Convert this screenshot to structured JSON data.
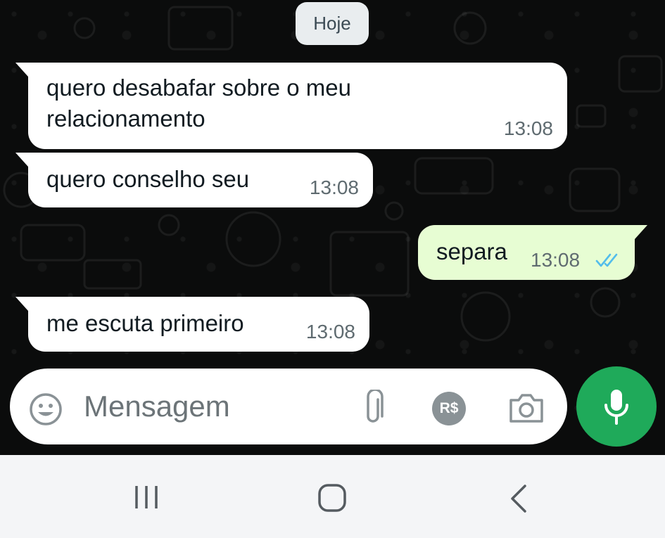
{
  "chat": {
    "date_label": "Hoje",
    "messages": [
      {
        "direction": "incoming",
        "line1": "quero desabafar sobre o meu",
        "line2": "relacionamento",
        "time": "13:08"
      },
      {
        "direction": "incoming",
        "text": "quero conselho seu",
        "time": "13:08"
      },
      {
        "direction": "outgoing",
        "text": "separa",
        "time": "13:08",
        "status_icon": "double-check-read-icon"
      },
      {
        "direction": "incoming",
        "text": "me escuta primeiro",
        "time": "13:08"
      }
    ]
  },
  "composer": {
    "placeholder": "Mensagem",
    "icons": [
      "emoji-icon",
      "attach-icon",
      "payment-icon",
      "camera-icon",
      "mic-icon"
    ],
    "payment_label": "R$"
  },
  "navigation": {
    "icons": [
      "recent-apps-icon",
      "home-icon",
      "back-icon"
    ]
  },
  "colors": {
    "chat_background": "#0b0c0c",
    "incoming_bubble": "#ffffff",
    "outgoing_bubble": "#e7fdd3",
    "accent_green": "#1faa5a",
    "read_ticks": "#53bdeb",
    "nav_bar": "#f4f5f7"
  }
}
